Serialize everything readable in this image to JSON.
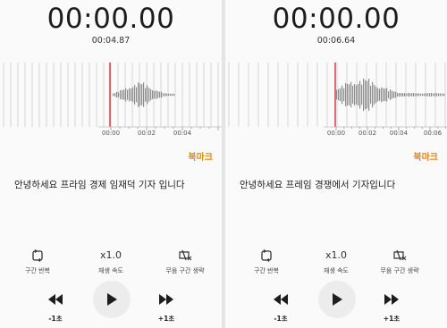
{
  "panels": [
    {
      "timer": "00:00.00",
      "elapsed": "00:04.87",
      "ticks": [
        "00:00",
        "00:02",
        "00:04"
      ],
      "bookmark": "북마크",
      "transcript": "안녕하세요 프라임 경제 임재덕 기자 입니다",
      "controls": {
        "repeat": "구간 반복",
        "speed_value": "x1.0",
        "speed": "재생 속도",
        "skip_silence": "무음 구간 생략",
        "rewind": "-1초",
        "forward": "+1초"
      }
    },
    {
      "timer": "00:00.00",
      "elapsed": "00:06.64",
      "ticks": [
        "00:00",
        "00:02",
        "00:04",
        "00:06"
      ],
      "bookmark": "북마크",
      "transcript": "안녕하세요 프레임 경쟁에서 기자입니다",
      "controls": {
        "repeat": "구간 반복",
        "speed_value": "x1.0",
        "speed": "재생 속도",
        "skip_silence": "무음 구간 생략",
        "rewind": "-1초",
        "forward": "+1초"
      }
    }
  ],
  "colors": {
    "accent": "#e08a1e",
    "playhead": "#d4322f",
    "wave": "#8c8c8c",
    "grid": "#d6d6d6"
  }
}
